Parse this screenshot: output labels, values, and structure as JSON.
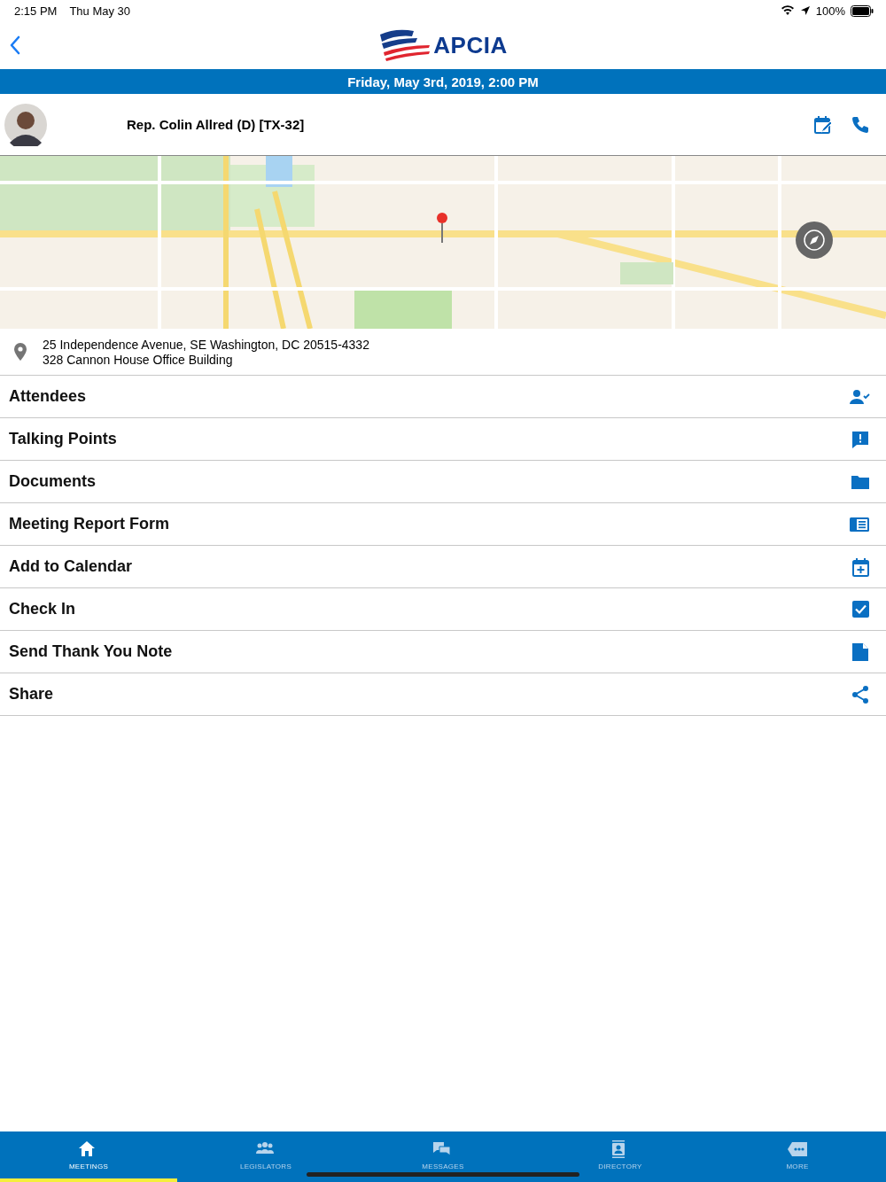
{
  "status_bar": {
    "time": "2:15 PM",
    "date": "Thu May 30",
    "battery": "100%"
  },
  "header": {
    "logo_text": "APCIA"
  },
  "date_bar": "Friday, May 3rd, 2019, 2:00 PM",
  "legislator": {
    "name": "Rep. Colin Allred (D) [TX-32]"
  },
  "address": {
    "line1": "25 Independence Avenue, SE Washington, DC 20515-4332",
    "line2": "328 Cannon House Office Building"
  },
  "actions": [
    {
      "label": "Attendees",
      "kind": "attendees"
    },
    {
      "label": "Talking Points",
      "kind": "talking"
    },
    {
      "label": "Documents",
      "kind": "folder"
    },
    {
      "label": "Meeting Report Form",
      "kind": "form"
    },
    {
      "label": "Add to Calendar",
      "kind": "calendar"
    },
    {
      "label": "Check In",
      "kind": "check"
    },
    {
      "label": "Send Thank You Note",
      "kind": "note"
    },
    {
      "label": "Share",
      "kind": "share"
    }
  ],
  "tab_bar": [
    {
      "label": "MEETINGS",
      "kind": "home",
      "selected": true
    },
    {
      "label": "LEGISLATORS",
      "kind": "people",
      "selected": false
    },
    {
      "label": "MESSAGES",
      "kind": "chat",
      "selected": false
    },
    {
      "label": "DIRECTORY",
      "kind": "contact",
      "selected": false
    },
    {
      "label": "MORE",
      "kind": "more",
      "selected": false
    }
  ]
}
